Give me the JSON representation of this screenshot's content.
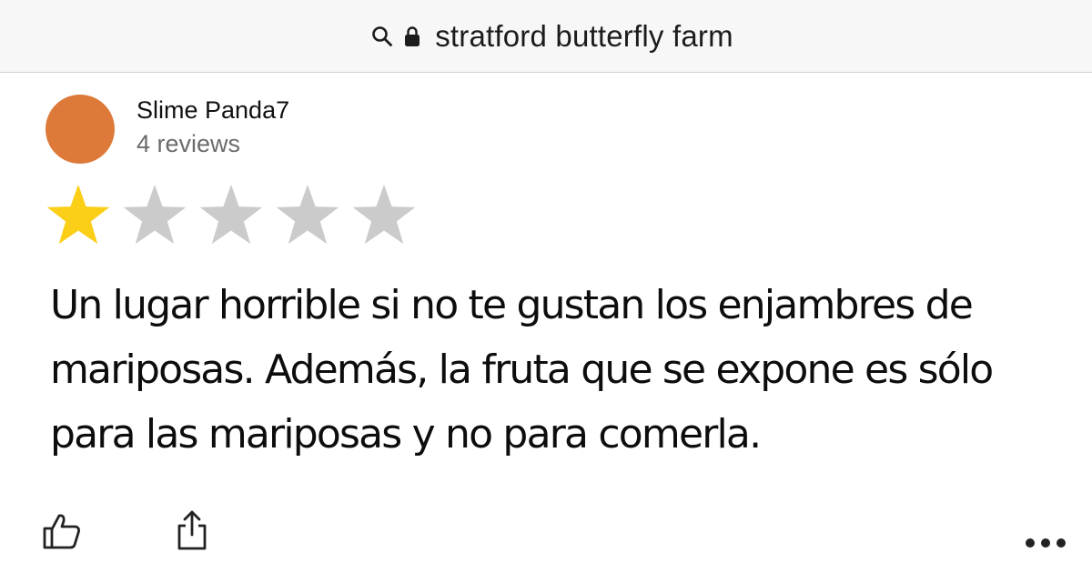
{
  "search": {
    "query": "stratford butterfly farm"
  },
  "review": {
    "author": "Slime Panda7",
    "author_reviews": "4 reviews",
    "avatar_color": "#dd7a3a",
    "rating": 1,
    "max_rating": 5,
    "star_filled_color": "#fbce17",
    "star_empty_color": "#cbcbcb",
    "text": "Un lugar horrible si no te gustan los enjambres de mariposas. Además, la fruta que se expone es sólo para las mariposas y no para comerla."
  },
  "actions": {
    "like_icon": "thumbs-up-icon",
    "share_icon": "share-icon",
    "more_icon": "more-options-icon"
  }
}
